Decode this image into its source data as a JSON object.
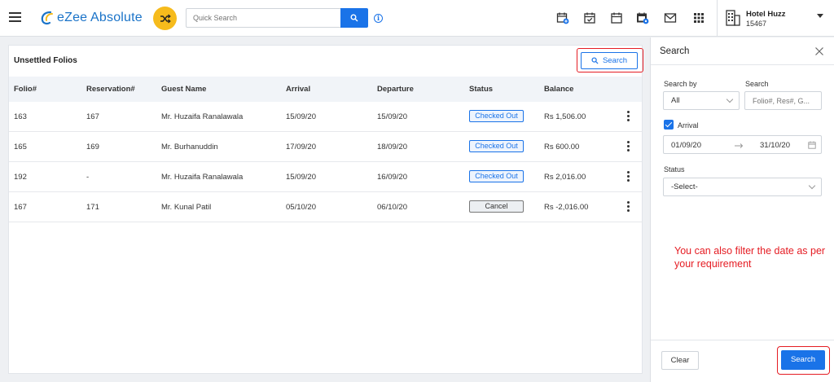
{
  "app": {
    "brand": "eZee Absolute",
    "search_placeholder": "Quick Search"
  },
  "hotel": {
    "name": "Hotel Huzz",
    "id": "15467"
  },
  "folios": {
    "title": "Unsettled Folios",
    "search_label": "Search",
    "columns": [
      "Folio#",
      "Reservation#",
      "Guest Name",
      "Arrival",
      "Departure",
      "Status",
      "Balance"
    ],
    "rows": [
      {
        "folio": "163",
        "reservation": "167",
        "guest": "Mr. Huzaifa Ranalawala",
        "arrival": "15/09/20",
        "departure": "15/09/20",
        "status": "Checked Out",
        "balance": "Rs 1,506.00"
      },
      {
        "folio": "165",
        "reservation": "169",
        "guest": "Mr. Burhanuddin",
        "arrival": "17/09/20",
        "departure": "18/09/20",
        "status": "Checked Out",
        "balance": "Rs 600.00"
      },
      {
        "folio": "192",
        "reservation": "-",
        "guest": "Mr. Huzaifa Ranalawala",
        "arrival": "15/09/20",
        "departure": "16/09/20",
        "status": "Checked Out",
        "balance": "Rs 2,016.00"
      },
      {
        "folio": "167",
        "reservation": "171",
        "guest": "Mr. Kunal Patil",
        "arrival": "05/10/20",
        "departure": "06/10/20",
        "status": "Cancel",
        "balance": "Rs -2,016.00"
      }
    ]
  },
  "panel": {
    "title": "Search",
    "search_by_label": "Search by",
    "search_by_value": "All",
    "search_label": "Search",
    "search_placeholder": "Folio#, Res#, G...",
    "arrival_label": "Arrival",
    "arrival_checked": true,
    "date_from": "01/09/20",
    "date_to": "31/10/20",
    "status_label": "Status",
    "status_value": "-Select-",
    "note": "You can also filter the date as per your requirement",
    "clear_label": "Clear",
    "search_button_label": "Search"
  },
  "colors": {
    "accent": "#1a73e8",
    "brand_badge": "#f6bb1c",
    "highlight": "#e51c23"
  },
  "icons": {
    "top": [
      "calendar-add-icon",
      "calendar-check-icon",
      "calendar-icon",
      "calendar-settings-icon",
      "mail-icon",
      "apps-grid-icon"
    ]
  }
}
